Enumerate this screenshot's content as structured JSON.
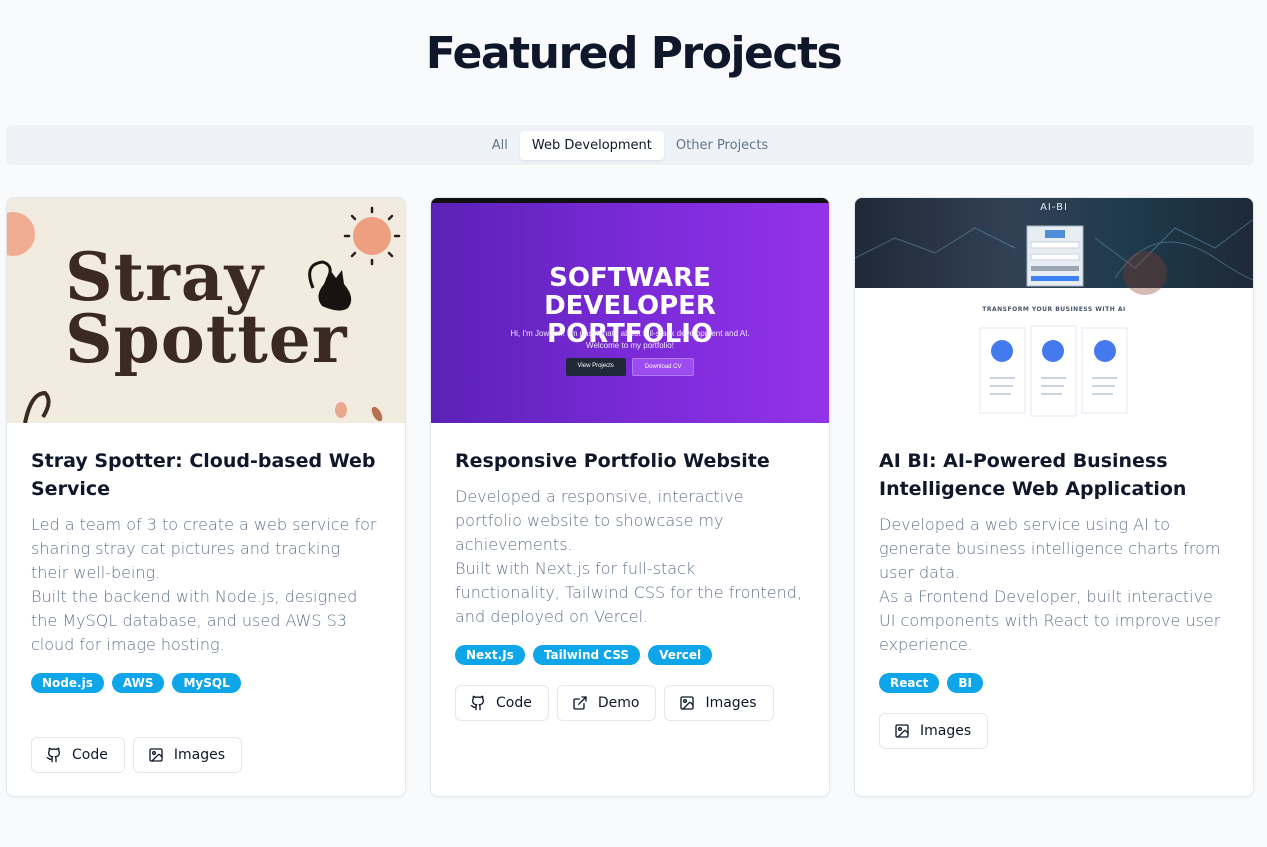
{
  "page": {
    "title": "Featured Projects"
  },
  "tabs": [
    {
      "label": "All",
      "active": false
    },
    {
      "label": "Web Development",
      "active": true
    },
    {
      "label": "Other Projects",
      "active": false
    }
  ],
  "colors": {
    "accent": "#0ea5e9",
    "text": "#0f172a",
    "muted": "#64748b"
  },
  "projects": [
    {
      "title": "Stray Spotter: Cloud-based Web Service",
      "image_text": "Stray Spotter",
      "description": [
        "Led a team of 3 to create a web service for sharing stray cat pictures and tracking their well-being.",
        "Built the backend with Node.js, designed the MySQL database, and used AWS S3 cloud for image hosting."
      ],
      "tags": [
        "Node.js",
        "AWS",
        "MySQL"
      ],
      "actions": [
        {
          "label": "Code",
          "icon": "github-icon"
        },
        {
          "label": "Images",
          "icon": "image-icon"
        }
      ]
    },
    {
      "title": "Responsive Portfolio Website",
      "image": {
        "heading": "SOFTWARE DEVELOPER PORTFOLIO",
        "line1": "Hi, I'm Jowoon! I'm passionate about full-stack development and AI.",
        "line2": "Welcome to my portfolio!",
        "btn1": "View Projects",
        "btn2": "Download CV"
      },
      "description": [
        "Developed a responsive, interactive portfolio website to showcase my achievements.",
        "Built with Next.js for full-stack functionality, Tailwind CSS for the frontend, and deployed on Vercel."
      ],
      "tags": [
        "Next.Js",
        "Tailwind CSS",
        "Vercel"
      ],
      "actions": [
        {
          "label": "Code",
          "icon": "github-icon"
        },
        {
          "label": "Demo",
          "icon": "external-link-icon"
        },
        {
          "label": "Images",
          "icon": "image-icon"
        }
      ]
    },
    {
      "title": "AI BI: AI-Powered Business Intelligence Web Application",
      "image": {
        "brand": "AI-BI",
        "heading": "TRANSFORM YOUR BUSINESS WITH AI"
      },
      "description": [
        "Developed a web service using AI to generate business intelligence charts from user data.",
        "As a Frontend Developer, built interactive UI components with React to improve user experience."
      ],
      "tags": [
        "React",
        "BI"
      ],
      "actions": [
        {
          "label": "Images",
          "icon": "image-icon"
        }
      ]
    }
  ]
}
